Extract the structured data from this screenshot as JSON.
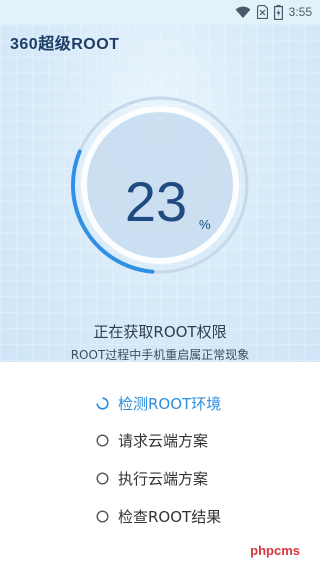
{
  "status_bar": {
    "time": "3:55"
  },
  "app": {
    "title": "360超级ROOT"
  },
  "progress": {
    "percent": 23,
    "unit": "%",
    "value_fraction": 0.23
  },
  "status": {
    "title": "正在获取ROOT权限",
    "subtitle": "ROOT过程中手机重启属正常现象"
  },
  "steps": [
    {
      "label": "检测ROOT环境",
      "state": "in-progress"
    },
    {
      "label": "请求云端方案",
      "state": "pending"
    },
    {
      "label": "执行云端方案",
      "state": "pending"
    },
    {
      "label": "检查ROOT结果",
      "state": "pending"
    }
  ],
  "watermark": "phpcms",
  "colors": {
    "accent": "#2a8ee0",
    "hero_bg": "#d6eaf9",
    "number": "#1f4b80"
  },
  "icons": [
    "wifi-icon",
    "sim-no-signal-icon",
    "battery-charging-icon",
    "spinner-icon",
    "radio-circle-icon"
  ]
}
